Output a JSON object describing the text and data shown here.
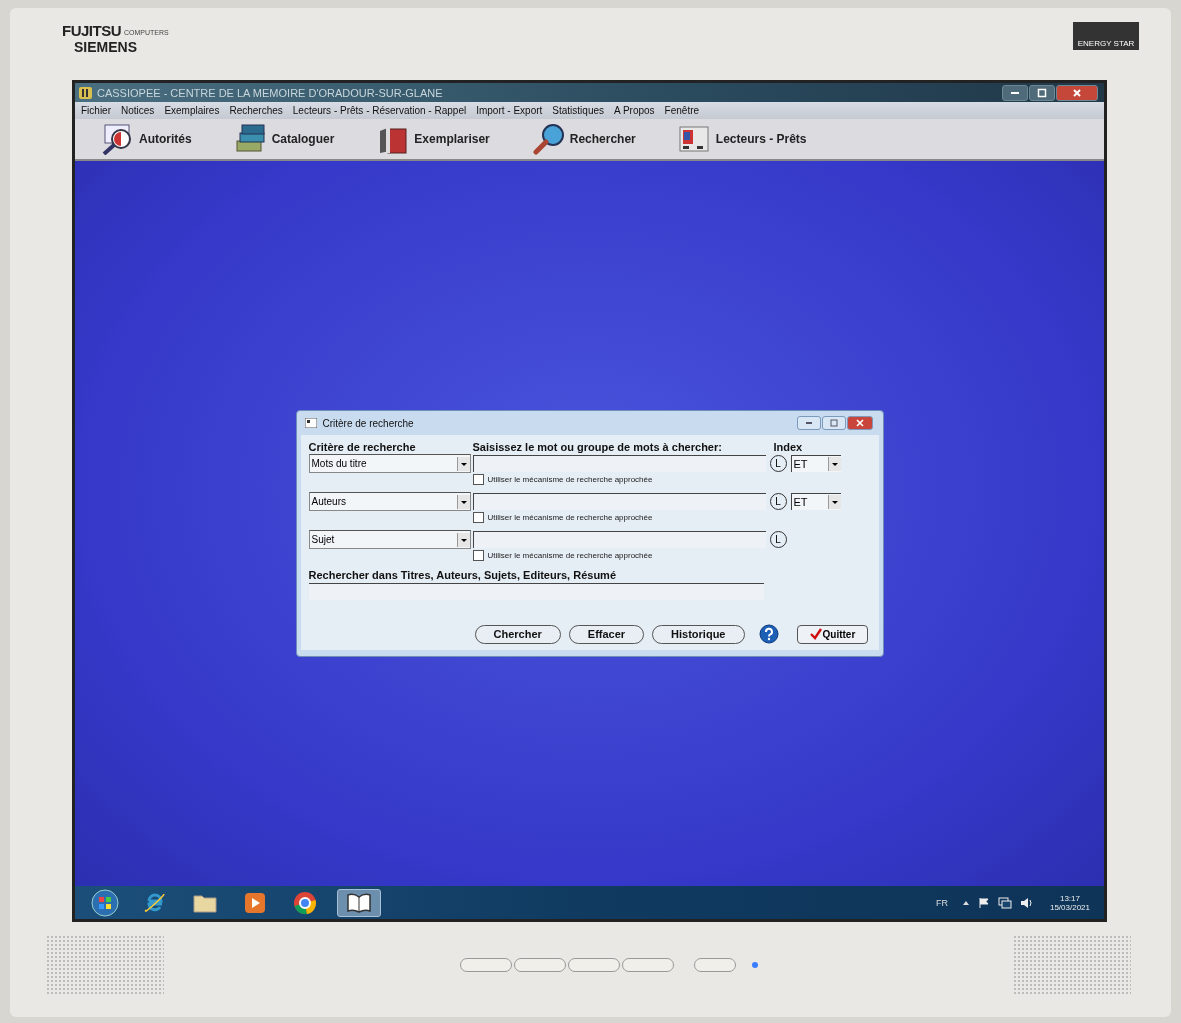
{
  "monitor": {
    "brand": "FUJITSU",
    "brand_sub": "COMPUTERS",
    "brand_line2": "SIEMENS",
    "badge": "ENERGY STAR"
  },
  "app": {
    "title": "CASSIOPEE  -  CENTRE DE LA MEMOIRE D'ORADOUR-SUR-GLANE",
    "menu": [
      "Fichier",
      "Notices",
      "Exemplaires",
      "Recherches",
      "Lecteurs - Prêts - Réservation - Rappel",
      "Import - Export",
      "Statistiques",
      "A Propos",
      "Fenêtre"
    ],
    "toolbar": [
      {
        "label": "Autorités",
        "kind": "authority"
      },
      {
        "label": "Cataloguer",
        "kind": "catalog"
      },
      {
        "label": "Exemplariser",
        "kind": "copies"
      },
      {
        "label": "Rechercher",
        "kind": "search"
      },
      {
        "label": "Lecteurs - Prêts",
        "kind": "readers"
      }
    ]
  },
  "dialog": {
    "title": "Critère de recherche",
    "criteria_header": "Critère de recherche",
    "input_header": "Saisissez le mot ou groupe de mots à chercher:",
    "index_header": "Index",
    "rows": [
      {
        "field": "Mots du titre",
        "index": "L",
        "operator": "ET",
        "approx_label": "Utiliser le mécanisme de recherche approchée",
        "approx_checked": false
      },
      {
        "field": "Auteurs",
        "index": "L",
        "operator": "ET",
        "approx_label": "Utiliser le mécanisme de recherche approchée",
        "approx_checked": false
      },
      {
        "field": "Sujet",
        "index": "L",
        "approx_label": "Utiliser le mécanisme de recherche approchée",
        "approx_checked": false
      }
    ],
    "fulltext_label": "Rechercher dans Titres, Auteurs, Sujets, Editeurs, Résumé",
    "buttons": [
      {
        "label": "Chercher",
        "kind": "text"
      },
      {
        "label": "Effacer",
        "kind": "text"
      },
      {
        "label": "Historique",
        "kind": "text"
      },
      {
        "kind": "help"
      },
      {
        "label": "Quitter",
        "kind": "quit"
      }
    ]
  },
  "taskbar": {
    "items": [
      {
        "kind": "start",
        "selected": false
      },
      {
        "kind": "browser",
        "selected": false
      },
      {
        "kind": "folder",
        "selected": false
      },
      {
        "kind": "media",
        "selected": false
      },
      {
        "kind": "chrome",
        "selected": false
      },
      {
        "kind": "book",
        "selected": true
      }
    ],
    "language": "FR",
    "time": "13:17",
    "date": "15/03/2021"
  }
}
